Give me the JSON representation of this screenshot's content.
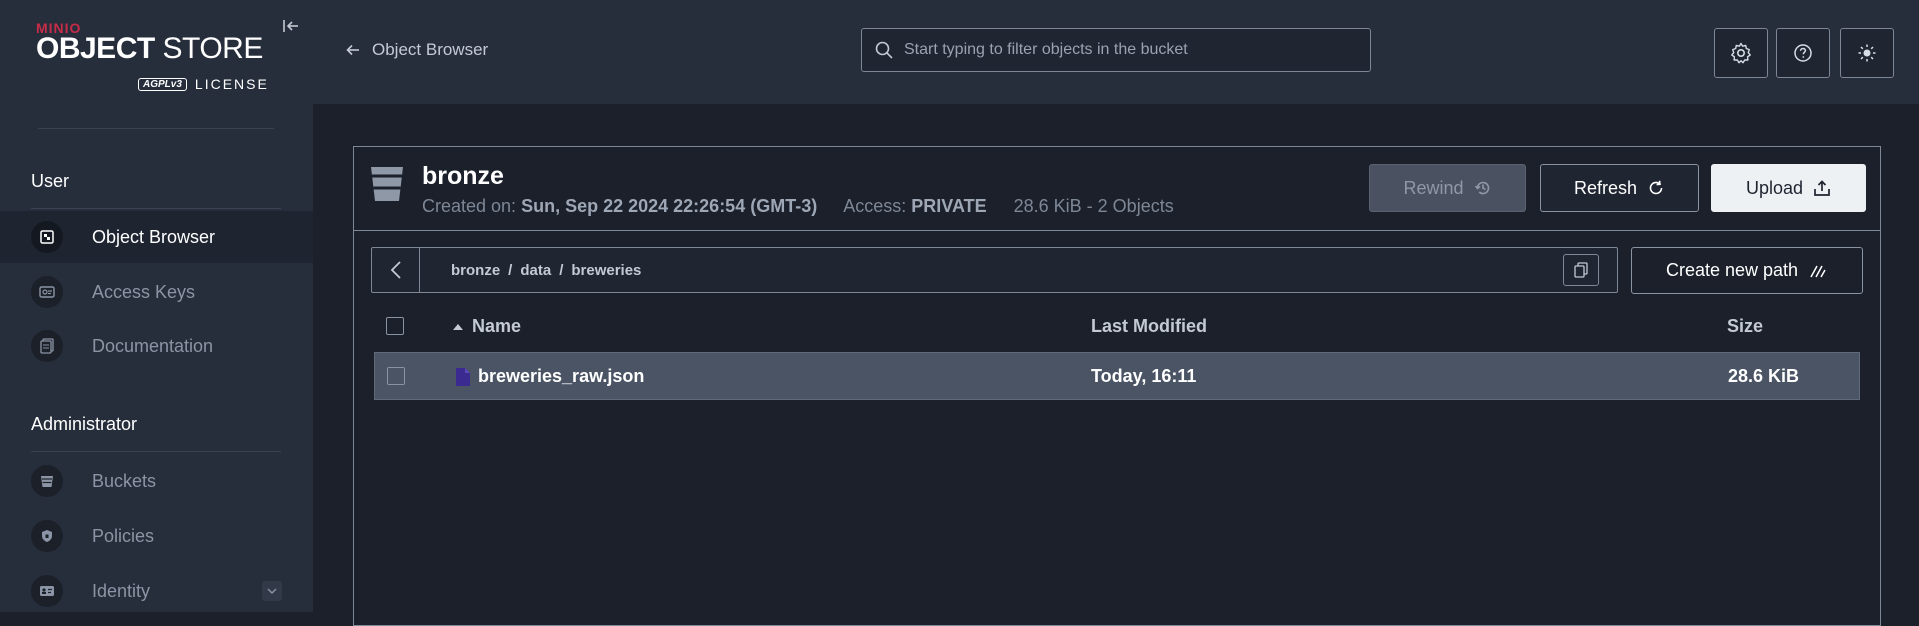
{
  "brand": {
    "maker": "MINIO",
    "product_bold": "OBJECT",
    "product_rest": " STORE",
    "license_badge": "AGPLv3",
    "license": "LICENSE"
  },
  "sidebar": {
    "sections": [
      {
        "title": "User",
        "items": [
          {
            "label": "Object Browser",
            "icon": "object-browser-icon",
            "active": true
          },
          {
            "label": "Access Keys",
            "icon": "access-keys-icon"
          },
          {
            "label": "Documentation",
            "icon": "documentation-icon"
          }
        ]
      },
      {
        "title": "Administrator",
        "items": [
          {
            "label": "Buckets",
            "icon": "bucket-icon"
          },
          {
            "label": "Policies",
            "icon": "policy-shield-icon"
          },
          {
            "label": "Identity",
            "icon": "identity-card-icon",
            "expandable": true
          }
        ]
      }
    ]
  },
  "topbar": {
    "back_label": "Object Browser",
    "search_placeholder": "Start typing to filter objects in the bucket",
    "buttons": [
      "gear-icon",
      "help-icon",
      "theme-sun-icon"
    ]
  },
  "bucket": {
    "name": "bronze",
    "created_label": "Created on:",
    "created_value": "Sun, Sep 22 2024 22:26:54 (GMT-3)",
    "access_label": "Access:",
    "access_value": "PRIVATE",
    "size_summary": "28.6 KiB - 2 Objects"
  },
  "actions": {
    "rewind": "Rewind",
    "refresh": "Refresh",
    "upload": "Upload"
  },
  "path": {
    "crumbs": [
      "bronze",
      "data",
      "breweries"
    ],
    "separator": "/"
  },
  "new_path_label": "Create new path",
  "table": {
    "columns": {
      "name": "Name",
      "modified": "Last Modified",
      "size": "Size"
    },
    "sort": {
      "column": "Name",
      "direction": "ascending"
    },
    "rows": [
      {
        "name": "breweries_raw.json",
        "modified": "Today, 16:11",
        "size": "28.6 KiB",
        "icon": "file-icon",
        "selected_highlight": true
      }
    ]
  },
  "colors": {
    "accent_brand": "#c72c48",
    "sidebar_bg": "#262d3b",
    "page_bg": "#1b202b",
    "file_icon": "#3b2a8f"
  }
}
